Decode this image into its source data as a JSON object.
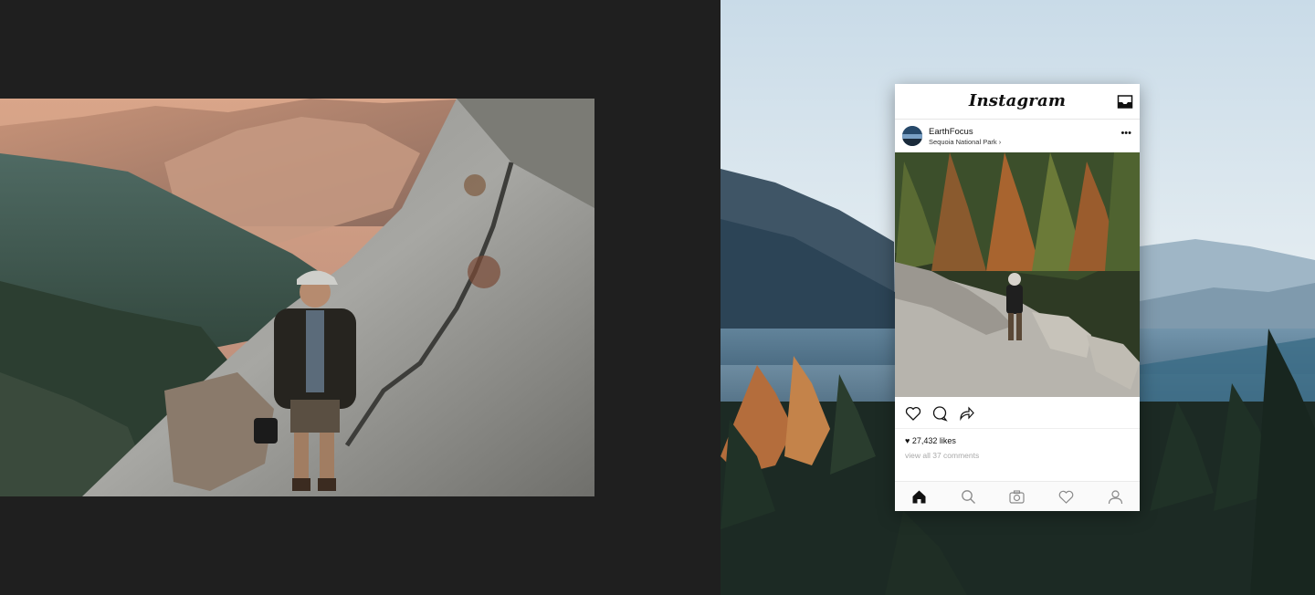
{
  "instagram": {
    "logo_text": "Instagram",
    "post": {
      "username": "EarthFocus",
      "location": "Sequoia National Park ›",
      "likes": "27,432 likes",
      "comments_link": "view all 37 comments"
    }
  },
  "icons": {
    "topbar": [
      "inbox-icon"
    ],
    "post_header": [
      "more-options-icon"
    ],
    "actions": [
      "like-icon",
      "comment-icon",
      "share-icon"
    ],
    "bottom_nav": [
      "home-icon",
      "search-icon",
      "camera-icon",
      "activity-heart-icon",
      "profile-icon"
    ]
  },
  "colors": {
    "canvas_dark": "#1f1f1f",
    "sky": "#d9e7f0",
    "phone_bg": "#ffffff",
    "secondary_text": "#a9a9a9"
  }
}
